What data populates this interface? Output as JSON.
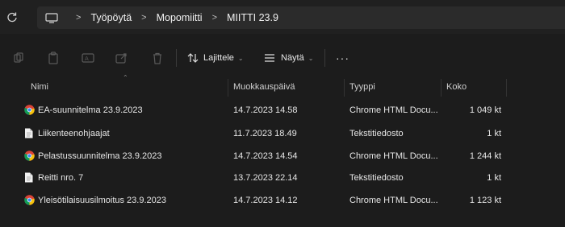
{
  "address": {
    "crumbs": [
      "Työpöytä",
      "Mopomiitti",
      "MIITTI 23.9"
    ],
    "separator": ">"
  },
  "toolbar": {
    "sort_label": "Lajittele",
    "view_label": "Näytä",
    "more_label": "···"
  },
  "columns": {
    "name": "Nimi",
    "modified": "Muokkauspäivä",
    "type": "Tyyppi",
    "size": "Koko"
  },
  "files": [
    {
      "name": "EA-suunnitelma 23.9.2023",
      "modified": "14.7.2023 14.58",
      "type": "Chrome HTML Docu...",
      "size": "1 049 kt",
      "icon": "chrome-icon"
    },
    {
      "name": "Liikenteenohjaajat",
      "modified": "11.7.2023 18.49",
      "type": "Tekstitiedosto",
      "size": "1 kt",
      "icon": "text-file-icon"
    },
    {
      "name": "Pelastussuunnitelma 23.9.2023",
      "modified": "14.7.2023 14.54",
      "type": "Chrome HTML Docu...",
      "size": "1 244 kt",
      "icon": "chrome-icon"
    },
    {
      "name": "Reitti nro. 7",
      "modified": "13.7.2023 22.14",
      "type": "Tekstitiedosto",
      "size": "1 kt",
      "icon": "text-file-icon"
    },
    {
      "name": "Yleisötilaisuusilmoitus 23.9.2023",
      "modified": "14.7.2023 14.12",
      "type": "Chrome HTML Docu...",
      "size": "1 123 kt",
      "icon": "chrome-icon"
    }
  ],
  "colors": {
    "background": "#1c1c1c",
    "addressbar": "#2b2b2b",
    "text": "#e6e6e6",
    "disabled_icon": "#5a5a5a"
  }
}
